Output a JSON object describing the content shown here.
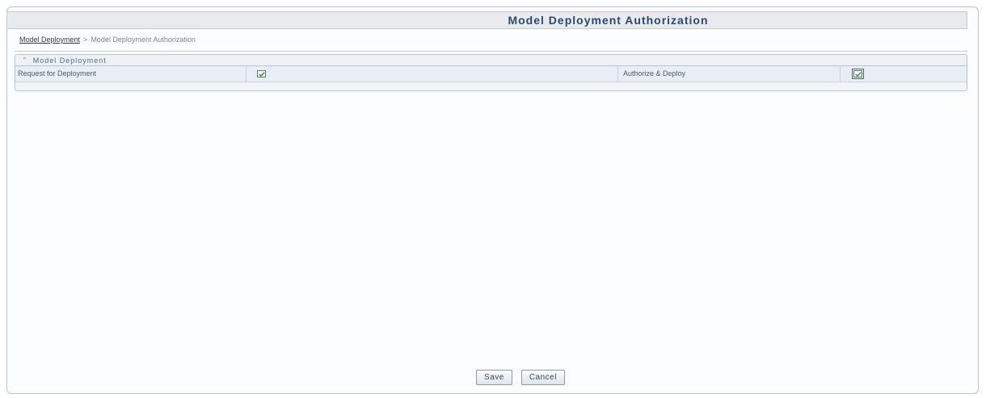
{
  "page": {
    "title": "Model Deployment Authorization"
  },
  "breadcrumb": {
    "link": "Model Deployment",
    "separator": ">",
    "current": "Model Deployment Authorization"
  },
  "section": {
    "title": "Model Deployment",
    "collapse_icon": "chevron-up-icon",
    "rows": [
      {
        "label1": "Request for Deployment",
        "checkbox1_checked": true,
        "label2": "Authorize & Deploy",
        "checkbox2_checked": true
      }
    ]
  },
  "buttons": {
    "save_label": "Save",
    "cancel_label": "Cancel"
  },
  "colors": {
    "title_text": "#2b4a6f",
    "section_row_bg": "#e7eef6",
    "checkbox_check": "#2f8f2f"
  }
}
